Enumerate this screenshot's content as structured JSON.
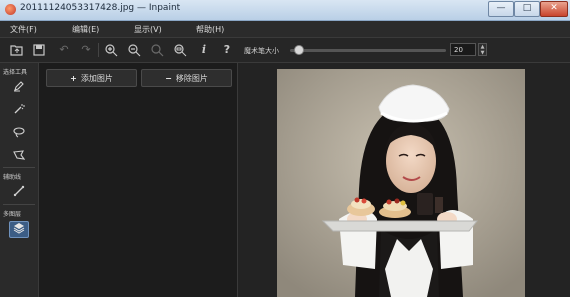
{
  "window": {
    "title": "20111124053317428.jpg — Inpaint",
    "buttons": {
      "minimize": "—",
      "maximize": "□",
      "close": "✕"
    }
  },
  "menu": {
    "items": [
      {
        "label": "文件(F)"
      },
      {
        "label": "编辑(E)"
      },
      {
        "label": "显示(V)"
      },
      {
        "label": "帮助(H)"
      }
    ]
  },
  "toolbar": {
    "icons": {
      "open": "folder-open-icon",
      "save": "save-icon",
      "undo": "undo-icon",
      "redo": "redo-icon",
      "zoom_in": "zoom-in-icon",
      "zoom_out": "zoom-out-icon",
      "zoom_actual": "zoom-actual-icon",
      "zoom_fit": "zoom-fit-icon",
      "info": "info-icon",
      "help": "help-icon"
    },
    "brush_size_label": "魔术笔大小",
    "brush_size_value": "20",
    "brush_slider_fraction": 0.03
  },
  "left_panel": {
    "selection_tools_label": "选择工具",
    "line_tool_label": "辅助线",
    "multi_layer_label": "多图层",
    "icons": {
      "marker": "marker-icon",
      "magic_wand": "magic-wand-icon",
      "lasso": "lasso-icon",
      "polygon_lasso": "polygon-lasso-icon",
      "line": "line-icon",
      "layers": "layers-icon"
    }
  },
  "image_panel": {
    "add_button": {
      "prefix": "+",
      "label": "添加图片"
    },
    "remove_button": {
      "prefix": "−",
      "label": "移除图片"
    }
  },
  "colors": {
    "accent": "#3c5d85",
    "background": "#1f1f1f"
  }
}
